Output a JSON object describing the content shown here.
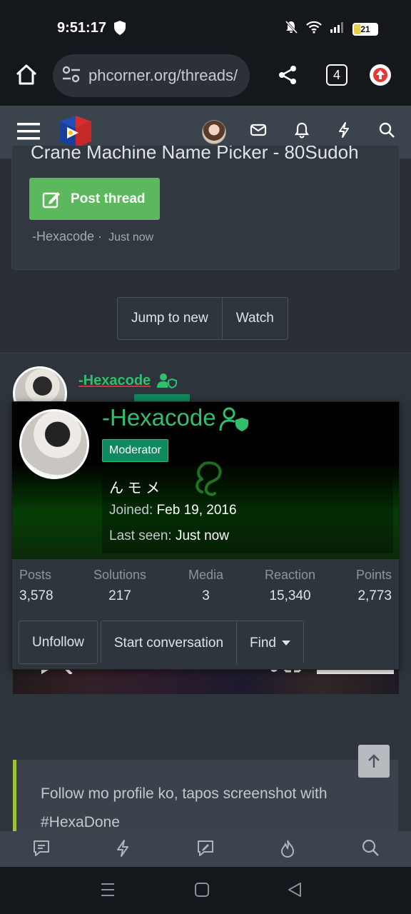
{
  "status": {
    "time": "9:51:17",
    "battery": "21"
  },
  "browser": {
    "url": "phcorner.org/threads/",
    "tab_count": "4"
  },
  "card": {
    "ghost_title": "Crane Machine Name Picker - 80Sudoh",
    "post_thread_label": "Post thread",
    "author": "-Hexacode",
    "separator": "·",
    "time": "Just now"
  },
  "actions": {
    "jump_label": "Jump to new",
    "watch_label": "Watch"
  },
  "post": {
    "username": "-Hexacode"
  },
  "popup": {
    "username": "-Hexacode",
    "role": "Moderator",
    "motto": "ん モ メ",
    "joined_label": "Joined:",
    "joined_value": "Feb 19, 2016",
    "seen_label": "Last seen:",
    "seen_value": "Just now",
    "stats": [
      {
        "label": "Posts",
        "value": "3,578"
      },
      {
        "label": "Solutions",
        "value": "217"
      },
      {
        "label": "Media",
        "value": "3"
      },
      {
        "label": "Reaction",
        "value": "15,340"
      },
      {
        "label": "Points",
        "value": "2,773"
      }
    ],
    "unfollow_label": "Unfollow",
    "conversation_label": "Start conversation",
    "find_label": "Find"
  },
  "quote": {
    "text": "Follow mo profile ko, tapos screenshot with #HexaDone"
  },
  "colors": {
    "accent_green": "#2fbf6f",
    "post_button": "#5cb85c",
    "moderator_badge": "#0e8a5f",
    "quote_bar": "#9cc23a"
  }
}
